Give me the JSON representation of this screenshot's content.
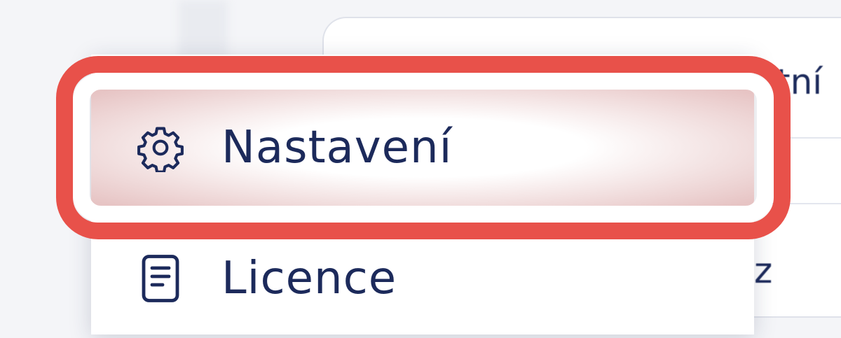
{
  "menu": {
    "items": [
      {
        "label": "Nastavení",
        "icon": "gear-icon",
        "highlighted": true
      },
      {
        "label": "Licence",
        "icon": "document-icon",
        "highlighted": false
      }
    ]
  },
  "background": {
    "fragment_top": "tní",
    "fragment_bottom": "z"
  },
  "annotation": {
    "color": "#e8514a"
  }
}
